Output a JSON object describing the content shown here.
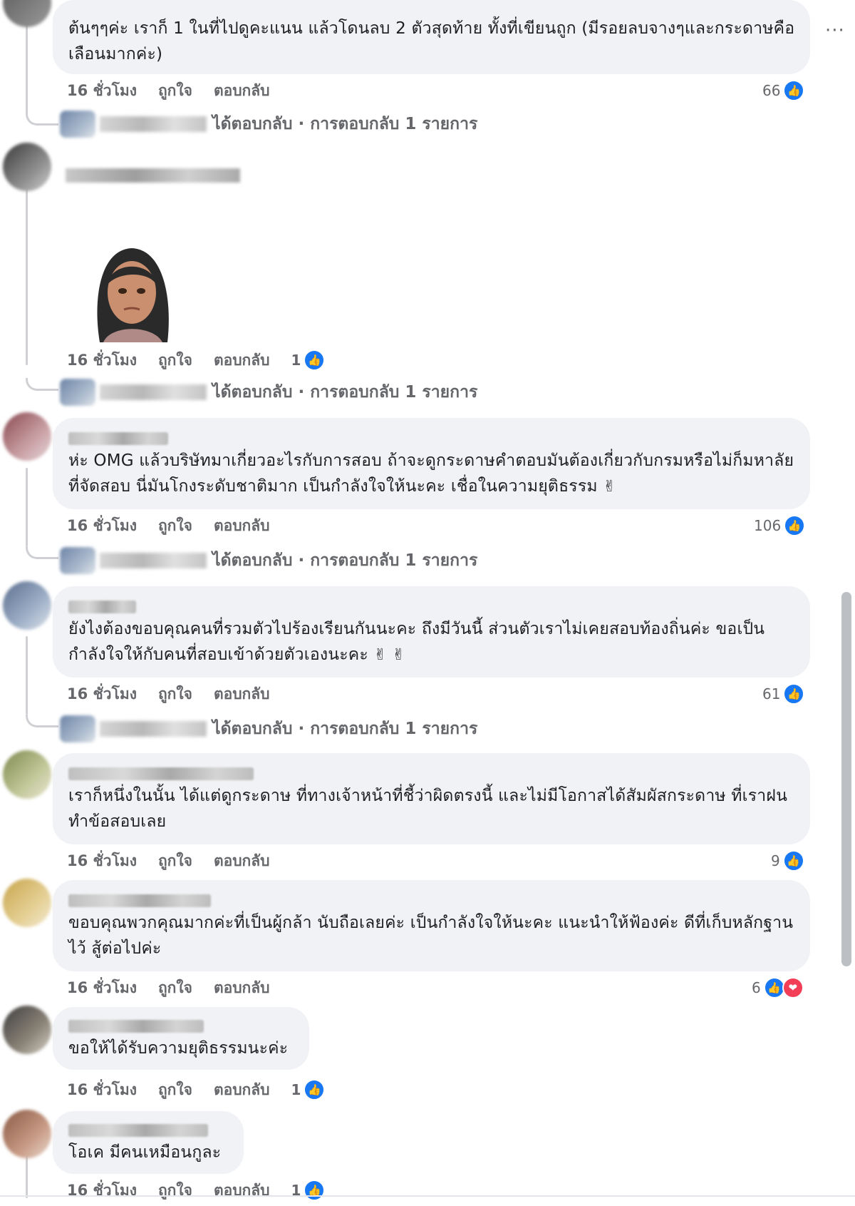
{
  "more_label": "···",
  "like_label": "ถูกใจ",
  "reply_label": "ตอบกลับ",
  "comments": [
    {
      "text": "ต้นๆๆค่ะ เราก็ 1 ในที่ไปดูคะแนน แล้วโดนลบ 2 ตัวสุดท้าย ทั้งที่เขียนถูก (มีรอยลบจางๆและกระดาษคือ เลือนมากค่ะ)",
      "time": "16 ชั่วโมง",
      "reactions": "66",
      "replies": "ได้ตอบกลับ · การตอบกลับ 1 รายการ"
    },
    {
      "text": "",
      "time": "16 ชั่วโมง",
      "reactions": "1",
      "replies": "ได้ตอบกลับ · การตอบกลับ 1 รายการ"
    },
    {
      "text": "ห่ะ OMG แล้วบริษัทมาเกี่ยวอะไรกับการสอบ ถ้าจะดูกระดาษคำตอบมันต้องเกี่ยวกับกรมหรือไม่ก็มหาลัยที่จัดสอบ นี่มันโกงระดับชาติมาก เป็นกำลังใจให้นะคะ เชื่อในความยุติธรรม",
      "emoji": "✌",
      "time": "16 ชั่วโมง",
      "reactions": "106",
      "replies": "ได้ตอบกลับ · การตอบกลับ 1 รายการ"
    },
    {
      "text": "ยังไงต้องขอบคุณคนที่รวมตัวไปร้องเรียนกันนะคะ ถึงมีวันนี้ ส่วนตัวเราไม่เคยสอบท้องถิ่นค่ะ ขอเป็นกำลังใจให้กับคนที่สอบเข้าด้วยตัวเองนะคะ",
      "emoji": "✌ ✌",
      "time": "16 ชั่วโมง",
      "reactions": "61",
      "replies": "ได้ตอบกลับ · การตอบกลับ 1 รายการ"
    },
    {
      "text": "เราก็หนึ่งในนั้น ได้แต่ดูกระดาษ ที่ทางเจ้าหน้าที่ชี้ว่าผิดตรงนี้ และไม่มีโอกาสได้สัมผัสกระดาษ ที่เราฝนทำข้อสอบเลย",
      "time": "16 ชั่วโมง",
      "reactions": "9"
    },
    {
      "text": "ขอบคุณพวกคุณมากค่ะที่เป็นผู้กล้า นับถือเลยค่ะ เป็นกำลังใจให้นะคะ แนะนำให้ฟ้องค่ะ ดีที่เก็บหลักฐานไว้ สู้ต่อไปค่ะ",
      "time": "16 ชั่วโมง",
      "reactions": "6"
    },
    {
      "text": "ขอให้ได้รับความยุติธรรมนะค่ะ",
      "time": "16 ชั่วโมง",
      "reactions": "1"
    },
    {
      "text": "โอเค มีคนเหมือนกูละ",
      "time": "16 ชั่วโมง",
      "reactions": "1"
    }
  ]
}
